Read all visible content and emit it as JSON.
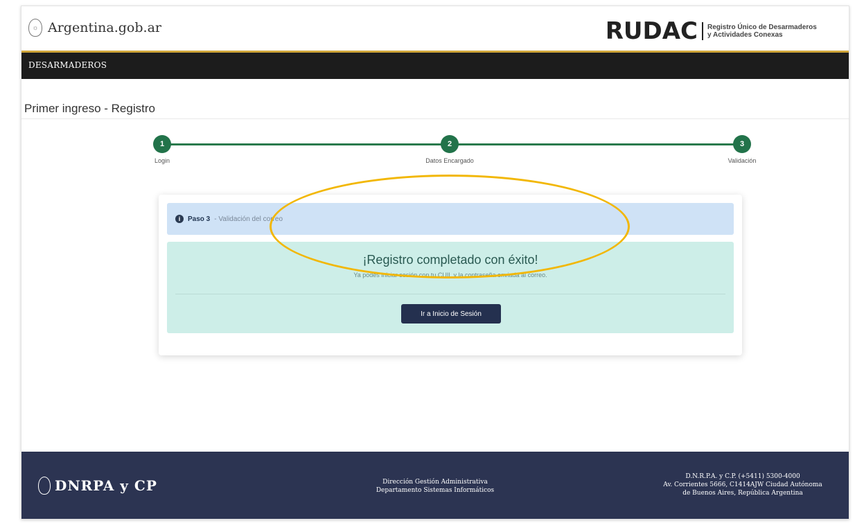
{
  "header": {
    "site_name": "Argentina.gob.ar",
    "rudac_logo": "RUDAC",
    "rudac_subtitle_line1": "Registro Único de Desarmaderos",
    "rudac_subtitle_line2": "y Actividades Conexas"
  },
  "navbar": {
    "item": "DESARMADEROS"
  },
  "page": {
    "title": "Primer ingreso - Registro"
  },
  "stepper": {
    "accent_color": "#22734a",
    "steps": [
      {
        "number": "1",
        "label": "Login"
      },
      {
        "number": "2",
        "label": "Datos Encargado"
      },
      {
        "number": "3",
        "label": "Validación"
      }
    ]
  },
  "info_alert": {
    "icon": "info-icon",
    "step_label": "Paso 3",
    "step_text": "- Validación del correo"
  },
  "success_alert": {
    "heading": "¡Registro completado con éxito!",
    "message": "Ya podés iniciar sesión con tu CUIL y la contraseña enviada al correo.",
    "button_label": "Ir a Inicio de Sesión"
  },
  "footer": {
    "logo_text": "DNRPA y CP",
    "center_line1": "Dirección Gestión Administrativa",
    "center_line2": "Departamento Sistemas Informáticos",
    "right_line1": "D.N.R.P.A. y C.P. (+5411) 5300-4000",
    "right_line2": "Av. Corrientes 5666, C1414AJW Ciudad Autónoma",
    "right_line3": "de Buenos Aires, República Argentina"
  },
  "colors": {
    "navbar": "#1c1c1c",
    "footer": "#2c3452",
    "info_bg": "#cfe2f6",
    "success_bg": "#cdeee8",
    "button": "#24304f",
    "highlight": "#f2b705"
  }
}
